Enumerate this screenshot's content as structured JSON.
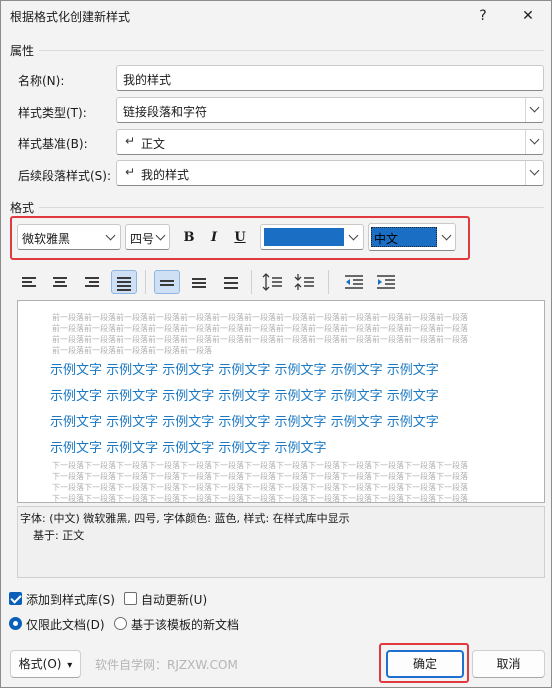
{
  "window": {
    "title": "根据格式化创建新样式",
    "help": "?",
    "close": "✕"
  },
  "properties": {
    "section": "属性",
    "name_label": "名称(N):",
    "name_value": "我的样式",
    "type_label": "样式类型(T):",
    "type_value": "链接段落和字符",
    "base_label": "样式基准(B):",
    "base_value": "正文",
    "next_label": "后续段落样式(S):",
    "next_value": "我的样式",
    "para_mark": "↵"
  },
  "format": {
    "section": "格式",
    "font": "微软雅黑",
    "size": "四号",
    "bold": "B",
    "italic": "I",
    "underline": "U",
    "font_color": "#1a6fc4",
    "script": "中文",
    "script_highlight": "#1a6fc4"
  },
  "preview": {
    "prev_para": "前一段落前一段落前一段落前一段落前一段落前一段落前一段落前一段落前一段落前一段落前一段落前一段落前一段落",
    "prev_para_short": "前一段落前一段落前一段落前一段落前一段落前一段落前一段落前一段落前一段落前一段落前一段落前一段落前一段落",
    "prev_para_tail": "前一段落前一段落前一段落前一段落前一段落",
    "sample_line": "示例文字 示例文字 示例文字 示例文字 示例文字 示例文字 示例文字",
    "sample_last": "示例文字 示例文字 示例文字 示例文字 示例文字",
    "next_para": "下一段落下一段落下一段落下一段落下一段落下一段落下一段落下一段落下一段落下一段落下一段落下一段落下一段落",
    "sample_color": "#1a78c2"
  },
  "description": {
    "line1": "字体: (中文) 微软雅黑, 四号, 字体颜色: 蓝色, 样式: 在样式库中显示",
    "line2": "基于: 正文"
  },
  "options": {
    "add_to_gallery": "添加到样式库(S)",
    "add_to_gallery_checked": true,
    "auto_update": "自动更新(U)",
    "auto_update_checked": false,
    "only_this_doc": "仅限此文档(D)",
    "new_docs_template": "基于该模板的新文档"
  },
  "buttons": {
    "format": "格式(O)",
    "format_arrow": "▾",
    "ok": "确定",
    "cancel": "取消"
  },
  "watermark": "软件自学网：RJZXW.COM"
}
